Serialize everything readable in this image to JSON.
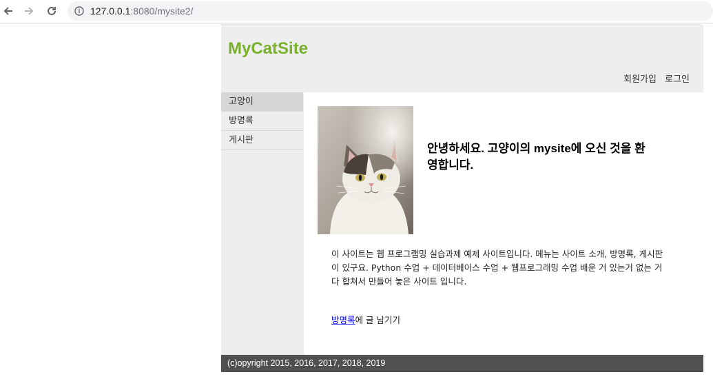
{
  "browser": {
    "url_host": "127.0.0.1",
    "url_rest": ":8080/mysite2/"
  },
  "header": {
    "site_title": "MyCatSite",
    "links": [
      "회원가입",
      "로그인"
    ]
  },
  "sidebar": {
    "items": [
      {
        "label": "고양이",
        "active": true
      },
      {
        "label": "방명록",
        "active": false
      },
      {
        "label": "게시판",
        "active": false
      }
    ]
  },
  "main": {
    "welcome": "안녕하세요. 고양이의 mysite에 오신 것을 환영합니다.",
    "description": "이 사이트는 웹 프로그램밍 실습과제 예제 사이트입니다. 메뉴는 사이트 소개, 방명록, 게시판이 있구요. Python 수업 + 데이터베이스 수업 + 웹프로그래밍 수업 배운 거 있는거 없는 거 다 합쳐서 만들어 놓은 사이트 입니다.",
    "guestbook_link": "방명록",
    "guestbook_suffix": "에 글 남기기"
  },
  "footer": {
    "copyright": "(c)opyright 2015, 2016, 2017, 2018, 2019"
  },
  "colors": {
    "brand": "#79b02c",
    "footer_bg": "#505050",
    "panel_bg": "#eeeeee"
  }
}
